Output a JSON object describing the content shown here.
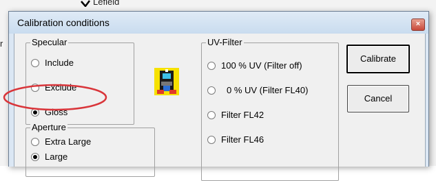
{
  "background": {
    "partial_text": "Lefield",
    "edge_char": "r"
  },
  "dialog": {
    "title": "Calibration conditions",
    "close_label": "×"
  },
  "specular": {
    "label": "Specular",
    "options": [
      {
        "label": "Include",
        "checked": false
      },
      {
        "label": "Exclude",
        "checked": false
      },
      {
        "label": "Gloss",
        "checked": true
      }
    ]
  },
  "aperture": {
    "label": "Aperture",
    "options": [
      {
        "label": "Extra Large",
        "checked": false
      },
      {
        "label": "Large",
        "checked": true
      }
    ]
  },
  "uv_filter": {
    "label": "UV-Filter",
    "options": [
      {
        "label": "100 % UV (Filter off)",
        "checked": false
      },
      {
        "label": "0 % UV (Filter FL40)",
        "checked": false
      },
      {
        "label": "Filter FL42",
        "checked": false
      },
      {
        "label": "Filter FL46",
        "checked": false
      }
    ]
  },
  "buttons": {
    "calibrate": "Calibrate",
    "cancel": "Cancel"
  },
  "colors": {
    "highlight": "#d9353a",
    "dialog_frame": "#dbe7f4",
    "client_bg": "#f0f0f0"
  },
  "icons": {
    "app_icon": "calibration-device-icon",
    "close_icon": "close-icon"
  }
}
